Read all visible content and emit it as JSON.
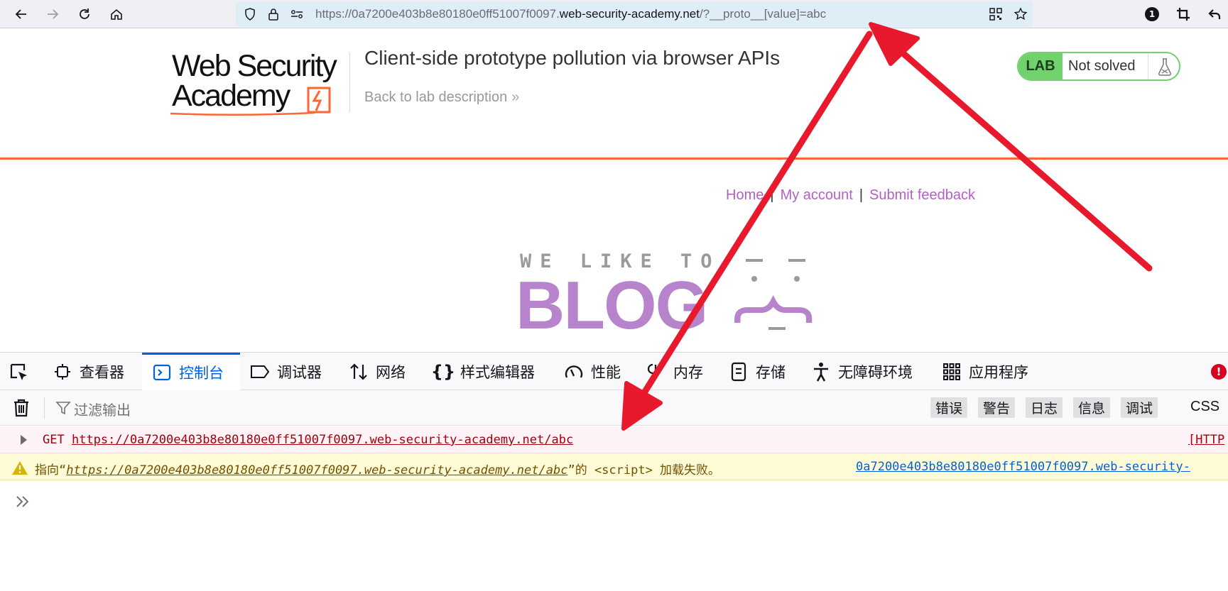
{
  "browser": {
    "url_prefix": "https://0a7200e403b8e80180e0ff51007f0097.",
    "url_host": "web-security-academy.net",
    "url_suffix": "/?__proto__[value]=abc",
    "notification_count": "1"
  },
  "lab": {
    "logo_line1": "Web Security",
    "logo_line2": "Academy",
    "title": "Client-side prototype pollution via browser APIs",
    "back_link": "Back to lab description",
    "badge": "LAB",
    "status": "Not solved"
  },
  "blog": {
    "nav": {
      "home": "Home",
      "account": "My account",
      "feedback": "Submit feedback",
      "separator": "|"
    },
    "banner_top": "WE LIKE TO",
    "banner_word": "BLOG"
  },
  "devtools": {
    "tabs": [
      {
        "label": "查看器",
        "icon": "inspector-icon"
      },
      {
        "label": "控制台",
        "icon": "console-icon"
      },
      {
        "label": "调试器",
        "icon": "debugger-icon"
      },
      {
        "label": "网络",
        "icon": "network-icon"
      },
      {
        "label": "样式编辑器",
        "icon": "style-editor-icon"
      },
      {
        "label": "性能",
        "icon": "performance-icon"
      },
      {
        "label": "内存",
        "icon": "memory-icon"
      },
      {
        "label": "存储",
        "icon": "storage-icon"
      },
      {
        "label": "无障碍环境",
        "icon": "accessibility-icon"
      },
      {
        "label": "应用程序",
        "icon": "application-icon"
      }
    ],
    "filter_placeholder": "过滤输出",
    "levels": [
      "错误",
      "警告",
      "日志",
      "信息",
      "调试"
    ],
    "css": "CSS",
    "error_msg": {
      "method": "GET",
      "url": "https://0a7200e403b8e80180e0ff51007f0097.web-security-academy.net/abc",
      "tag": "[HTTP"
    },
    "warn_msg": {
      "prefix": "指向“",
      "url": "https://0a7200e403b8e80180e0ff51007f0097.web-security-academy.net/abc",
      "suffix": "”的 <script> 加载失败。",
      "source": "0a7200e403b8e80180e0ff51007f0097.web-security-"
    }
  },
  "colors": {
    "accent_orange": "#ff6633",
    "lab_green": "#70d16d",
    "blog_purple": "#b784cb",
    "link_purple": "#b45fc8",
    "devtools_blue": "#0060df",
    "annotation_red": "#e8192c"
  }
}
